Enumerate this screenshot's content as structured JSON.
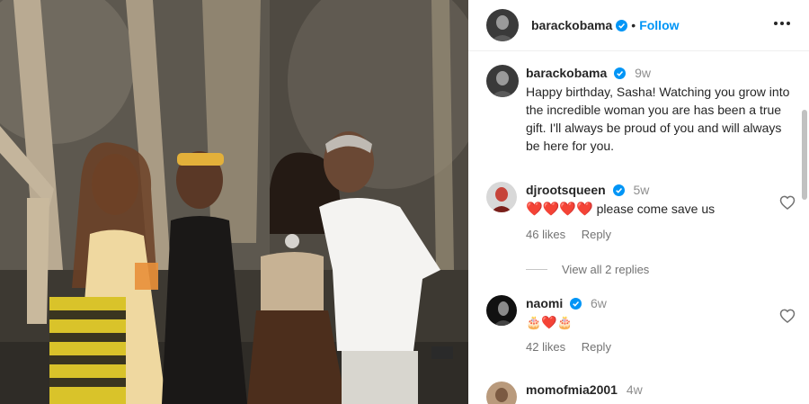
{
  "post": {
    "author": "barackobama",
    "follow_label": "Follow",
    "dot": "•"
  },
  "caption": {
    "username": "barackobama",
    "time": "9w",
    "text": "Happy birthday, Sasha! Watching you grow into the incredible woman you are has been a true gift. I'll always be proud of you and will always be here for you."
  },
  "comments": [
    {
      "username": "djrootsqueen",
      "time": "5w",
      "emoji": "❤️❤️❤️❤️",
      "text": "please come save us",
      "likes": "46 likes",
      "reply_label": "Reply"
    },
    {
      "username": "naomi",
      "time": "6w",
      "emoji": "🎂❤️🎂",
      "likes": "42 likes",
      "reply_label": "Reply"
    },
    {
      "username": "momofmia2001",
      "time": "4w"
    }
  ],
  "view_replies_label": "View all 2 replies",
  "colors": {
    "link_blue": "#0095f6",
    "verified_blue": "#0095f6",
    "heart_red": "#f0346b",
    "muted_text": "#737373"
  },
  "icons": {
    "verified": "verified-badge-icon",
    "more": "more-options-icon",
    "like": "heart-outline-icon"
  }
}
